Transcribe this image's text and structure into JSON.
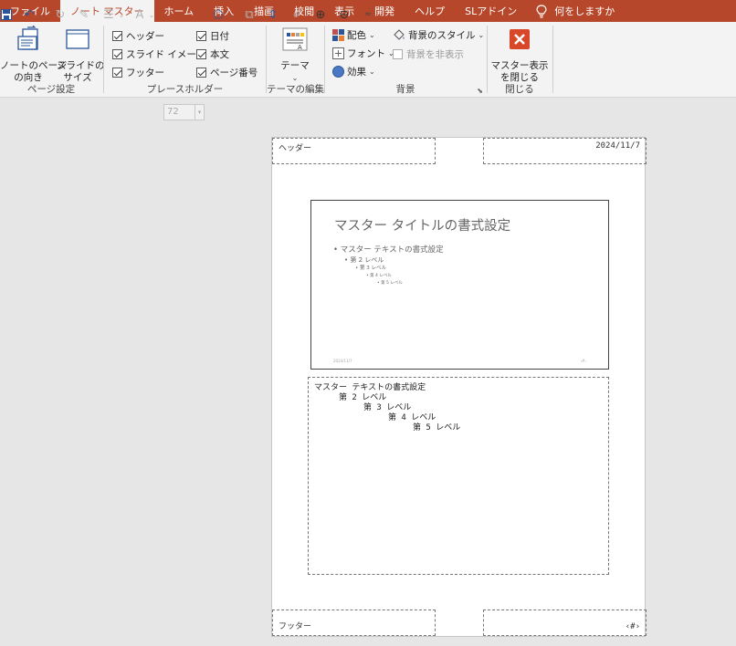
{
  "tabs": [
    "ファイル",
    "ノート マスター",
    "ホーム",
    "挿入",
    "描画",
    "校閲",
    "表示",
    "開発",
    "ヘルプ",
    "SLアドイン"
  ],
  "tell_me": "何をしますか",
  "ribbon": {
    "page_setup": {
      "notes_orientation": "ノートのページ\nの向き",
      "slide_size": "スライドの\nサイズ",
      "label": "ページ設定"
    },
    "placeholders": {
      "header": "ヘッダー",
      "slide_image": "スライド イメージ",
      "footer": "フッター",
      "date": "日付",
      "body": "本文",
      "page_number": "ページ番号",
      "label": "プレースホルダー"
    },
    "theme": {
      "button": "テーマ",
      "label": "テーマの編集"
    },
    "background": {
      "colors": "配色",
      "fonts": "フォント",
      "effects": "効果",
      "bg_styles": "背景のスタイル",
      "hide_bg": "背景を非表示",
      "label": "背景"
    },
    "close": {
      "button": "マスター表示\nを閉じる",
      "label": "閉じる"
    }
  },
  "qat": {
    "font_size": "72"
  },
  "page": {
    "header": "ヘッダー",
    "date": "2024/11/7",
    "footer": "フッター",
    "page_num": "‹#›",
    "slide": {
      "title": "マスター タイトルの書式設定",
      "bullets": [
        "マスター テキストの書式設定",
        "第 2 レベル",
        "第 3 レベル",
        "第 4 レベル",
        "第 5 レベル"
      ],
      "date": "2024/11/7",
      "num": "‹#›"
    },
    "notes": [
      "マスター テキストの書式設定",
      "第 2 レベル",
      "第 3 レベル",
      "第 4 レベル",
      "第 5 レベル"
    ]
  }
}
